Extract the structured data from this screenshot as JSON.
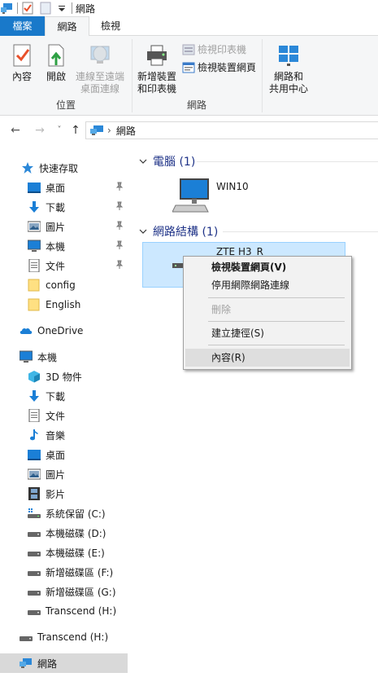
{
  "titlebar": {
    "title": "網路"
  },
  "tabs": {
    "file": "檔案",
    "network": "網路",
    "view": "檢視"
  },
  "ribbon": {
    "properties": "內容",
    "open": "開啟",
    "remote_line1": "連線至遠端",
    "remote_line2": "桌面連線",
    "group_location": "位置",
    "add_device_line1": "新增裝置",
    "add_device_line2": "和印表機",
    "view_printer": "檢視印表機",
    "view_device_page": "檢視裝置網頁",
    "group_network": "網路",
    "sharing_line1": "網路和",
    "sharing_line2": "共用中心"
  },
  "address": {
    "path": "網路"
  },
  "navpane": {
    "quick_access": "快速存取",
    "qa_items": [
      "桌面",
      "下載",
      "圖片",
      "本機",
      "文件",
      "config",
      "English"
    ],
    "onedrive": "OneDrive",
    "this_pc": "本機",
    "pc_items": [
      "3D 物件",
      "下載",
      "文件",
      "音樂",
      "桌面",
      "圖片",
      "影片",
      "系統保留 (C:)",
      "本機磁碟 (D:)",
      "本機磁碟 (E:)",
      "新增磁碟區 (F:)",
      "新增磁碟區 (G:)",
      "Transcend (H:)"
    ],
    "transcend": "Transcend (H:)",
    "network": "網路"
  },
  "content": {
    "group_computer": "電腦 (1)",
    "computer_name": "WIN10",
    "group_infra": "網路結構 (1)",
    "device_name": "ZTE H3_R"
  },
  "context_menu": {
    "view_webpage": "檢視裝置網頁(V)",
    "disable": "停用網際網路連線",
    "delete": "刪除",
    "shortcut": "建立捷徑(S)",
    "properties": "內容(R)"
  },
  "colors": {
    "accent": "#1979ca",
    "header_blue": "#1e3287",
    "selection": "#cce8ff"
  }
}
